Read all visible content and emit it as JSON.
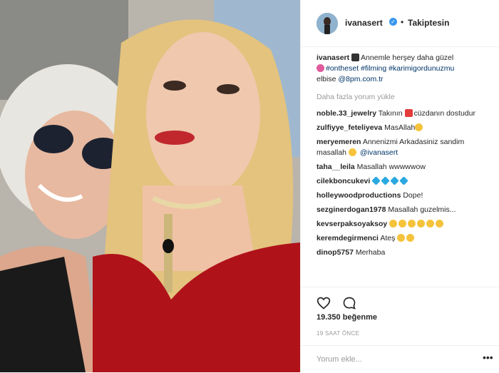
{
  "post": {
    "username": "ivanasert",
    "follow_status": "Takiptesin",
    "dot": "•",
    "caption_user": "ivanasert",
    "caption_text_1": "Annemle herşey daha güzel",
    "caption_tags": "#ontheset #filming #karimigordunuzmu",
    "caption_text_2": "elbise",
    "caption_mention": "@8pm.com.tr",
    "load_more": "Daha fazla yorum yükle",
    "likes": "19.350 beğenme",
    "time": "19 SAAT ÖNCE",
    "add_comment_placeholder": "Yorum ekle...",
    "more_options": "•••"
  },
  "comments": [
    {
      "user": "noble.33_jewelry",
      "text": "Takının",
      "text2": "cüzdanın dostudur"
    },
    {
      "user": "zulfiyye_feteliyeva",
      "text": "MasAllah"
    },
    {
      "user": "meryemeren",
      "text": "Annenizmi Arkadasiniz sandim masallah",
      "mention": "@ivanasert"
    },
    {
      "user": "taha__leila",
      "text": "Masallah wwwwwow"
    },
    {
      "user": "cilekboncukevi",
      "text": ""
    },
    {
      "user": "holleywoodproductions",
      "text": "Dope!"
    },
    {
      "user": "sezginerdogan1978",
      "text": "Masallah guzelmis..."
    },
    {
      "user": "kevserpaksoyaksoy",
      "text": ""
    },
    {
      "user": "keremdegirmenci",
      "text": "Ateş"
    },
    {
      "user": "dinop5757",
      "text": "Merhaba"
    }
  ],
  "icons": {
    "heart": "heart-icon",
    "comment": "comment-icon",
    "verified": "verified-badge-icon"
  },
  "colors": {
    "link": "#003569",
    "verified": "#3897f0",
    "muted": "#999999",
    "text": "#262626"
  }
}
